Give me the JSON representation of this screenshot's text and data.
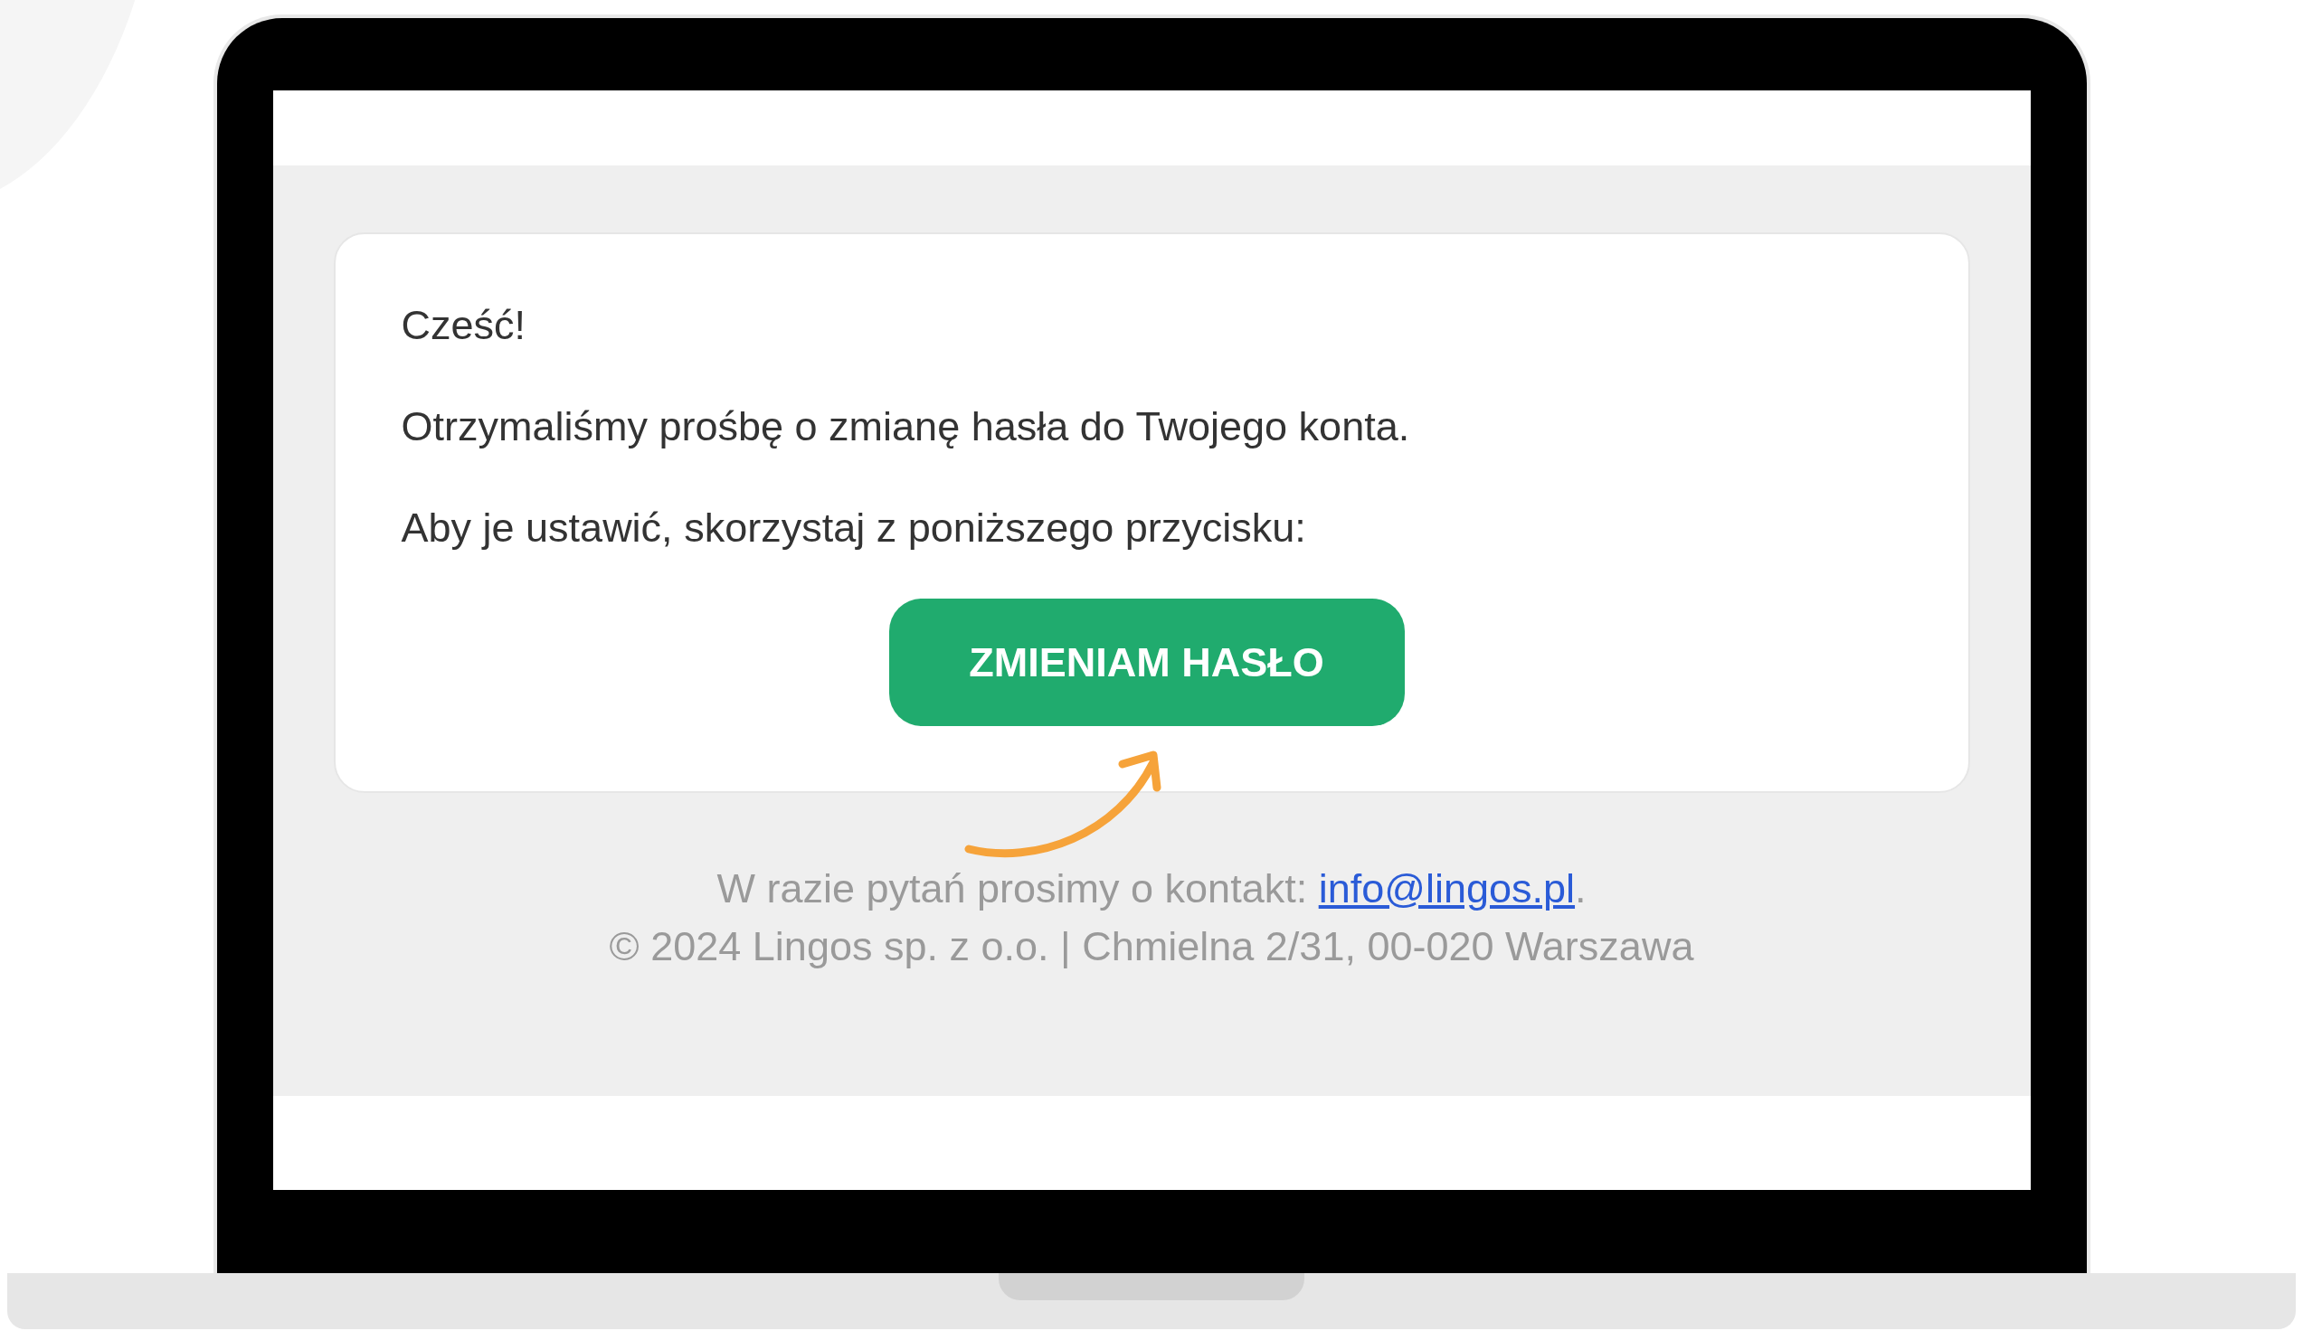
{
  "email": {
    "greeting": "Cześć!",
    "paragraphs": [
      "Otrzymaliśmy prośbę o zmianę hasła do Twojego konta.",
      "Aby je ustawić, skorzystaj z poniższego przycisku:"
    ],
    "button": {
      "label": "ZMIENIAM HASŁO"
    }
  },
  "footer": {
    "contact_text": "W razie pytań prosimy o kontakt: ",
    "contact_link": "info@lingos.pl",
    "contact_suffix": ".",
    "copyright": "© 2024 Lingos sp. z o.o. | Chmielna 2/31, 00-020 Warszawa"
  }
}
